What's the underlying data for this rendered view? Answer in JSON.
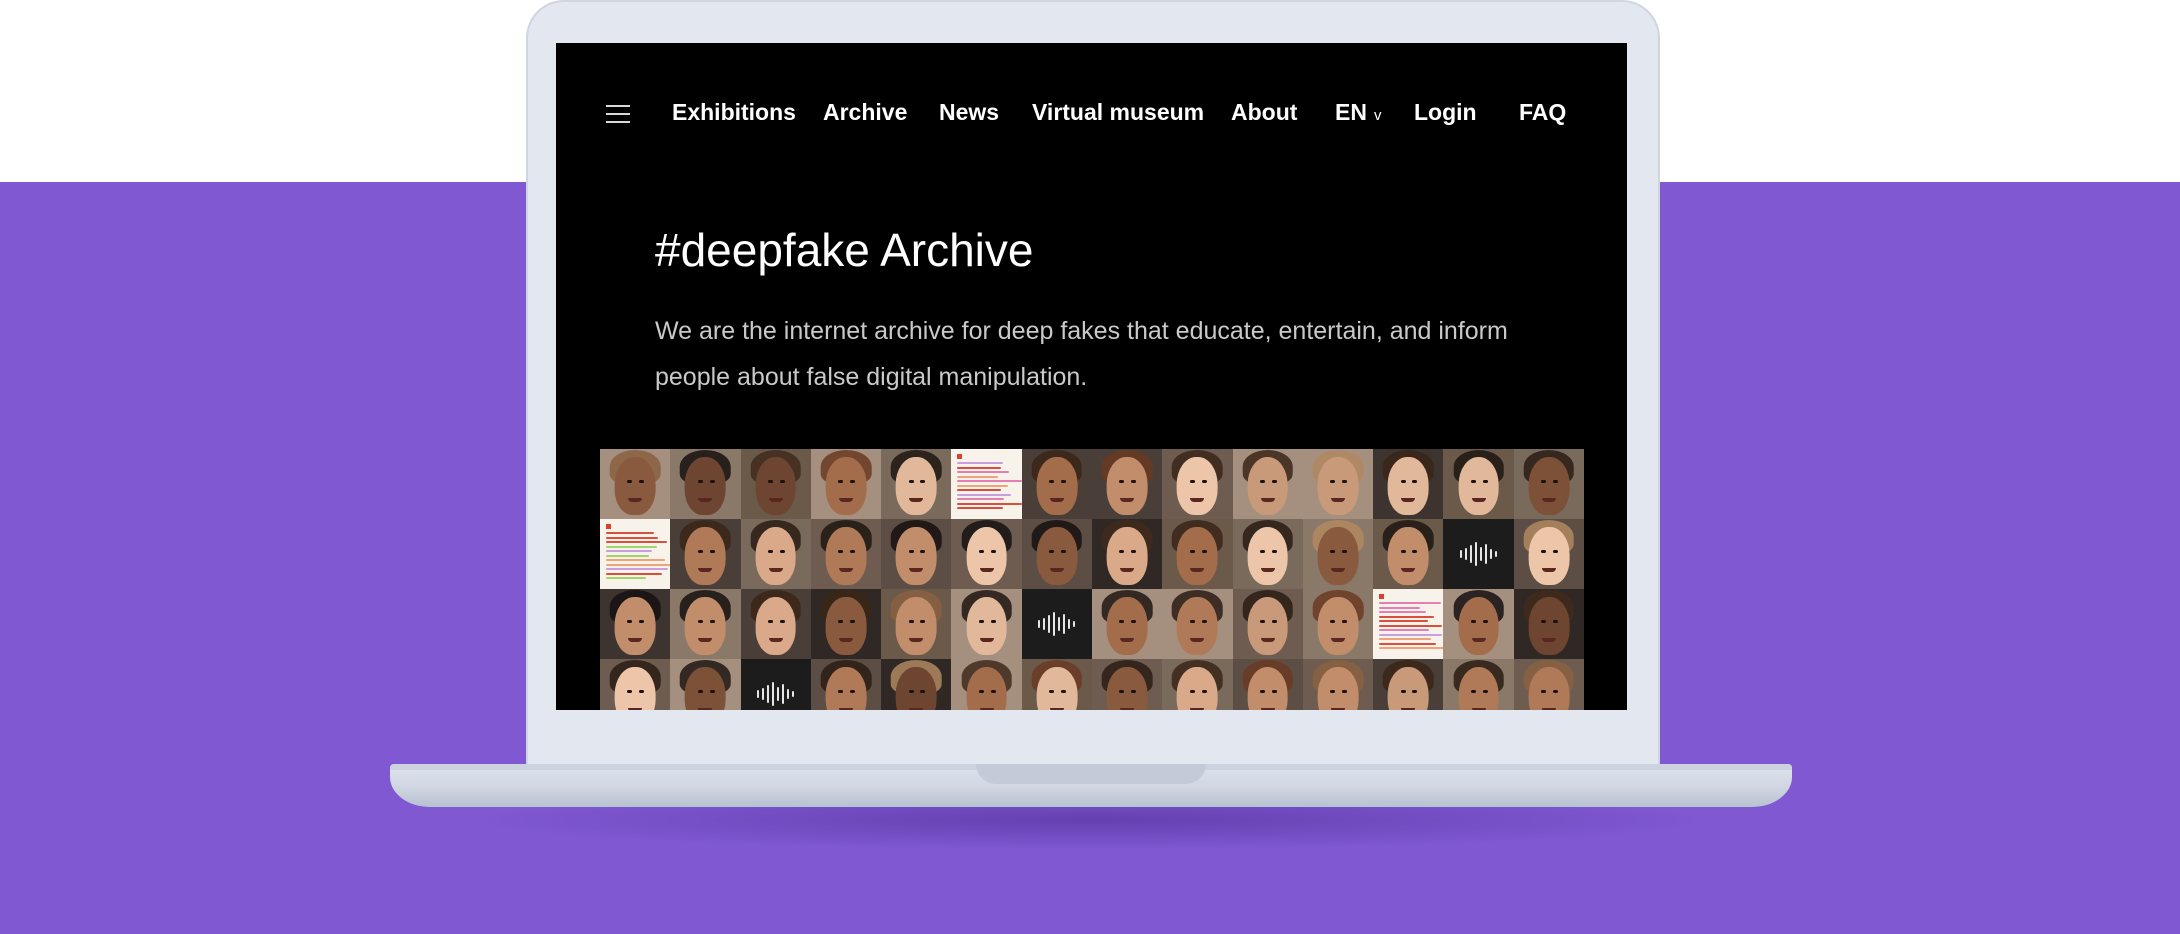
{
  "nav": {
    "menu_icon": "hamburger-menu-icon",
    "items": [
      {
        "id": "exhibitions",
        "label": "Exhibitions"
      },
      {
        "id": "archive",
        "label": "Archive"
      },
      {
        "id": "news",
        "label": "News"
      },
      {
        "id": "virtual-museum",
        "label": "Virtual museum"
      },
      {
        "id": "about",
        "label": "About"
      }
    ],
    "language": {
      "value": "EN",
      "chevron": "v"
    },
    "login_label": "Login",
    "faq_label": "FAQ"
  },
  "hero": {
    "title": "#deepfake Archive",
    "description": "We are the internet archive for deep fakes that educate, entertain, and inform people about false digital manipulation."
  },
  "gallery": {
    "rows": 4,
    "columns": 14,
    "special_tiles": [
      {
        "type": "text-document",
        "row": 1,
        "col": 6
      },
      {
        "type": "text-document",
        "row": 2,
        "col": 1
      },
      {
        "type": "audio-waveform",
        "row": 2,
        "col": 13
      },
      {
        "type": "audio-waveform",
        "row": 3,
        "col": 7
      },
      {
        "type": "text-document",
        "row": 3,
        "col": 12
      },
      {
        "type": "audio-waveform",
        "row": 4,
        "col": 3
      }
    ]
  },
  "colors": {
    "page_background": "#ffffff",
    "band_purple": "#7f58d2",
    "laptop_frame": "#e2e7f0",
    "screen_background": "#000000",
    "nav_text": "#ffffff",
    "description_text": "#c9c9c9"
  }
}
